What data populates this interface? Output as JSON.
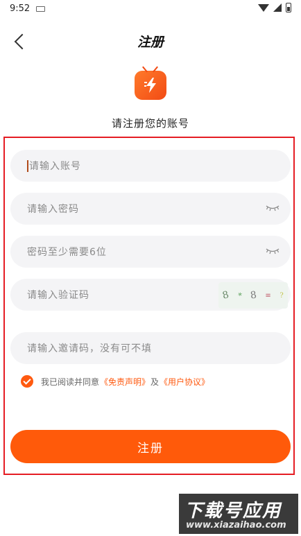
{
  "status_bar": {
    "time": "9:52"
  },
  "header": {
    "title": "注册"
  },
  "subtitle": "请注册您的账号",
  "form": {
    "account": {
      "placeholder": "请输入账号"
    },
    "password": {
      "placeholder": "请输入密码"
    },
    "password_hint": {
      "placeholder": "密码至少需要6位"
    },
    "captcha": {
      "placeholder": "请输入验证码",
      "image_chars": [
        "8",
        "*",
        "8",
        "≡",
        "?"
      ]
    },
    "invite": {
      "placeholder": "请输入邀请码，没有可不填"
    }
  },
  "agreement": {
    "checked": true,
    "prefix": "我已阅读并同意",
    "disclaimer_link": "《免责声明》",
    "conjunction": "及",
    "user_agreement_link": "《用户协议》"
  },
  "submit": {
    "label": "注册"
  },
  "watermark": {
    "text": "下载号应用",
    "url": "www.xiazaihao.com"
  },
  "colors": {
    "accent": "#ff5a0a",
    "highlight_border": "#e51c23",
    "field_bg": "#f4f4f6"
  },
  "icons": [
    "back-arrow-icon",
    "wifi-icon",
    "signal-icon",
    "battery-icon",
    "app-logo-icon",
    "eye-closed-icon",
    "check-icon"
  ]
}
